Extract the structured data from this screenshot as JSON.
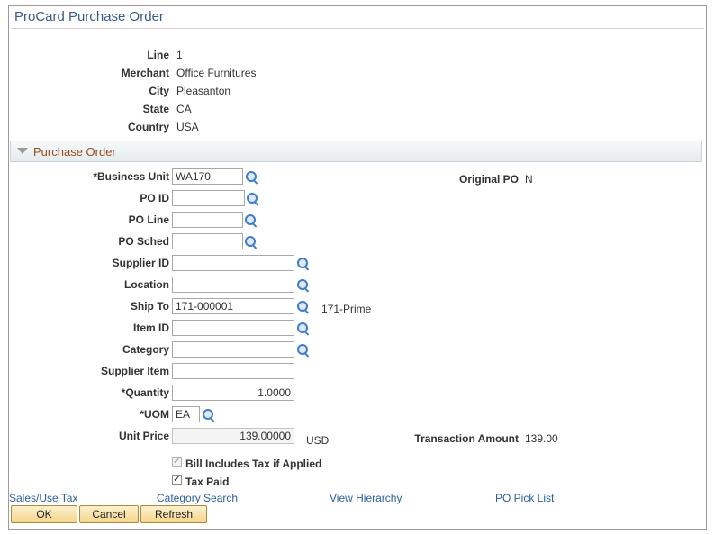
{
  "page": {
    "title": "ProCard Purchase Order"
  },
  "header_fields": {
    "line": {
      "label": "Line",
      "value": "1"
    },
    "merchant": {
      "label": "Merchant",
      "value": "Office Furnitures"
    },
    "city": {
      "label": "City",
      "value": "Pleasanton"
    },
    "state": {
      "label": "State",
      "value": "CA"
    },
    "country": {
      "label": "Country",
      "value": "USA"
    }
  },
  "section": {
    "title": "Purchase Order"
  },
  "form": {
    "business_unit": {
      "label": "*Business Unit",
      "value": "WA170"
    },
    "original_po": {
      "label": "Original PO",
      "value": "N"
    },
    "po_id": {
      "label": "PO ID",
      "value": ""
    },
    "po_line": {
      "label": "PO Line",
      "value": ""
    },
    "po_sched": {
      "label": "PO Sched",
      "value": ""
    },
    "supplier_id": {
      "label": "Supplier ID",
      "value": ""
    },
    "location": {
      "label": "Location",
      "value": ""
    },
    "ship_to": {
      "label": "Ship To",
      "value": "171-000001",
      "description": "171-Prime"
    },
    "item_id": {
      "label": "Item ID",
      "value": ""
    },
    "category": {
      "label": "Category",
      "value": ""
    },
    "supplier_item": {
      "label": "Supplier Item",
      "value": ""
    },
    "quantity": {
      "label": "*Quantity",
      "value": "1.0000"
    },
    "uom": {
      "label": "*UOM",
      "value": "EA"
    },
    "unit_price": {
      "label": "Unit Price",
      "value": "139.00000",
      "currency": "USD"
    },
    "transaction_amount": {
      "label": "Transaction Amount",
      "value": "139.00"
    }
  },
  "checkboxes": {
    "bill_includes_tax": {
      "label": "Bill Includes Tax if Applied",
      "checked": true,
      "disabled": true,
      "mark": "✓"
    },
    "tax_paid": {
      "label": "Tax Paid",
      "checked": true,
      "disabled": false,
      "mark": "✓"
    }
  },
  "links": {
    "sales_use_tax": "Sales/Use Tax",
    "category_search": "Category Search",
    "view_hierarchy": "View Hierarchy",
    "po_pick_list": "PO Pick List"
  },
  "buttons": {
    "ok": "OK",
    "cancel": "Cancel",
    "refresh": "Refresh"
  },
  "colors": {
    "title": "#3a5a8c",
    "section_title": "#9a4a1a",
    "link": "#2a5d9f",
    "button_bg": "#f4d58b",
    "lookup_icon": "#3f7cc9"
  }
}
